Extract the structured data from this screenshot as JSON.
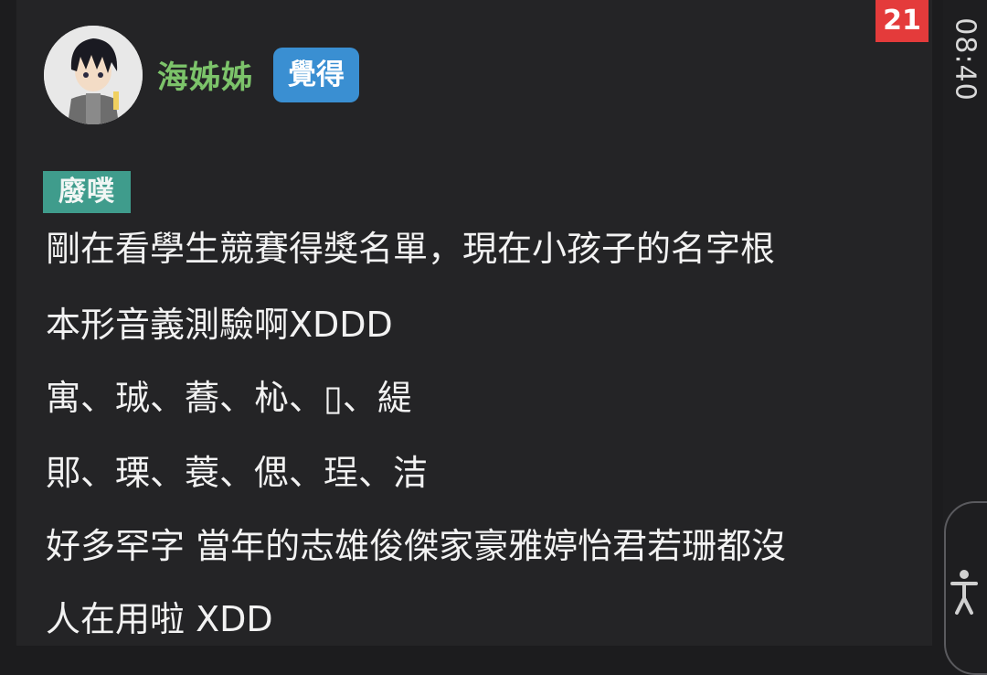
{
  "post": {
    "author": "海姊姊",
    "author_color": "#7cc36a",
    "tag": "覺得",
    "tag_color": "#3a8fd2",
    "sticker": "廢噗",
    "sticker_color": "#3f9c8c",
    "lines": [
      "剛在看學生競賽得獎名單，現在小孩子的名字根",
      "本形音義測驗啊XDDD",
      "寓、珹、蕎、杺、▯、緹",
      "郥、瑮、蓑、偲、珵、洁",
      "好多罕字 當年的志雄俊傑家豪雅婷怡君若珊都沒",
      "人在用啦 XDD"
    ]
  },
  "notification_badge": {
    "count": "21",
    "color": "#e43b3b"
  },
  "status_bar": {
    "time": "08:40"
  },
  "icons": {
    "avatar": "anime-figure-avatar",
    "accessibility": "accessibility-icon"
  }
}
